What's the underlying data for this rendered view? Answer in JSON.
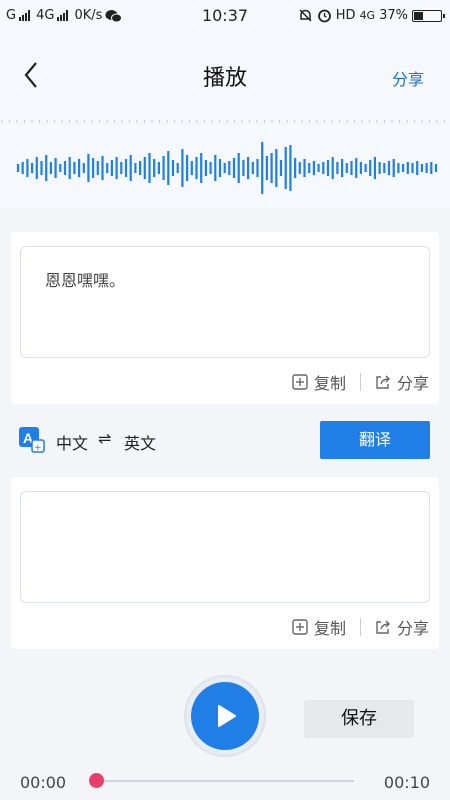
{
  "status_bar": {
    "carrier1": "G",
    "carrier2": "4G",
    "speed": "0K/s",
    "time": "10:37",
    "network": "HD",
    "network2": "4G",
    "battery": "37%"
  },
  "header": {
    "title": "播放",
    "share_label": "分享"
  },
  "recognized_text": "恩恩嘿嘿。",
  "translated_text": "",
  "actions": {
    "copy_label": "复制",
    "share_label": "分享"
  },
  "translate": {
    "from_lang": "中文",
    "swap_symbol": "⇌",
    "to_lang": "英文",
    "button_label": "翻译"
  },
  "player": {
    "save_label": "保存",
    "current_time": "00:00",
    "total_time": "00:10",
    "progress": 0.0
  },
  "colors": {
    "accent": "#1f7fe6",
    "link": "#1f72c9",
    "knob": "#e8406b"
  }
}
